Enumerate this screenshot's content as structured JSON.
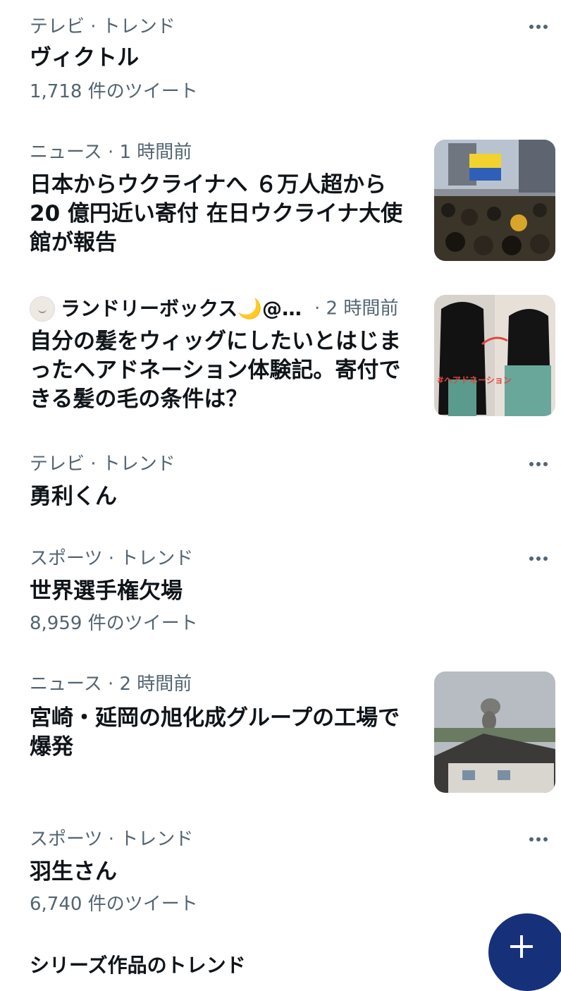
{
  "items": [
    {
      "category": "テレビ · トレンド",
      "title": "ヴィクトル",
      "count": "1,718 件のツイート"
    },
    {
      "category": "ニュース · 1 時間前",
      "title_lines": [
        "日本からウクライナへ ６万人超から",
        "20 億円近い寄付 在日ウクライナ大使",
        "館が報告"
      ]
    },
    {
      "author": "ランドリーボックス🌙@…",
      "time": "· 2 時間前",
      "title_lines": [
        "自分の髪をウィッグにしたいとはじま",
        "ったヘアドネーション体験記。寄付で",
        "きる髪の毛の条件は？"
      ],
      "thumb_text": "#ヘアドネーション"
    },
    {
      "category": "テレビ · トレンド",
      "title": "勇利くん"
    },
    {
      "category": "スポーツ · トレンド",
      "title": "世界選手権欠場",
      "count": "8,959 件のツイート"
    },
    {
      "category": "ニュース · 2 時間前",
      "title_lines": [
        "宮崎・延岡の旭化成グループの工場で",
        "爆発"
      ]
    },
    {
      "category": "スポーツ · トレンド",
      "title": "羽生さん",
      "count": "6,740 件のツイート"
    },
    {
      "category": "シリーズ作品のトレンド"
    }
  ],
  "icons": {
    "more": "more-icon",
    "fab": "plus-icon"
  },
  "colors": {
    "text": "#0f1419",
    "secondary": "#536471",
    "fab": "#16307a"
  }
}
